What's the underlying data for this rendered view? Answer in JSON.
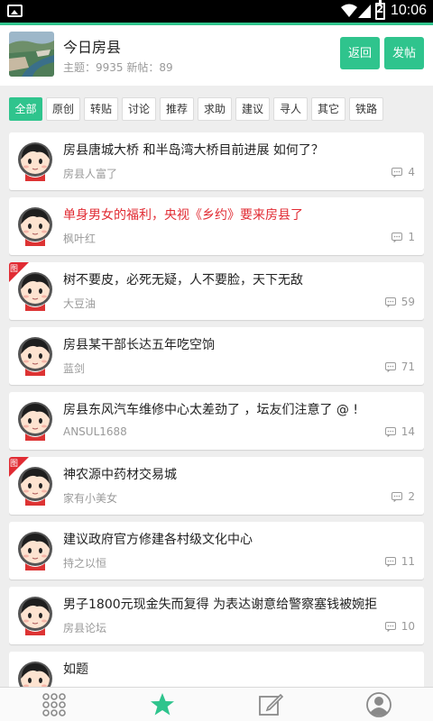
{
  "status_bar": {
    "time": "10:06",
    "battery_label": "2"
  },
  "header": {
    "title": "今日房县",
    "stats": "主题：9935 新帖：89",
    "back_label": "返回",
    "post_label": "发帖"
  },
  "tabs": [
    {
      "label": "全部",
      "active": true
    },
    {
      "label": "原创"
    },
    {
      "label": "转贴"
    },
    {
      "label": "讨论"
    },
    {
      "label": "推荐"
    },
    {
      "label": "求助"
    },
    {
      "label": "建议"
    },
    {
      "label": "寻人"
    },
    {
      "label": "其它"
    },
    {
      "label": "铁路"
    }
  ],
  "posts": [
    {
      "title": "房县唐城大桥 和半岛湾大桥目前进展 如何了？",
      "author": "房县人富了",
      "replies": "4"
    },
    {
      "title": "单身男女的福利，央视《乡约》要来房县了",
      "author": "枫叶红",
      "replies": "1",
      "highlight": true
    },
    {
      "title": "树不要皮，必死无疑，人不要脸，天下无敌",
      "author": "大豆油",
      "replies": "59",
      "has_image": true,
      "badge": "图"
    },
    {
      "title": "房县某干部长达五年吃空饷",
      "author": "蓝剑",
      "replies": "71"
    },
    {
      "title": "房县东风汽车维修中心太差劲了 ，坛友们注意了 @ !",
      "author": "ANSUL1688",
      "replies": "14"
    },
    {
      "title": "神农源中药材交易城",
      "author": "家有小美女",
      "replies": "2",
      "has_image": true,
      "badge": "图"
    },
    {
      "title": "建议政府官方修建各村级文化中心",
      "author": "持之以恒",
      "replies": "11"
    },
    {
      "title": "男子1800元现金失而复得 为表达谢意给警察塞钱被婉拒",
      "author": "房县论坛",
      "replies": "10"
    },
    {
      "title": "如题",
      "author": "",
      "replies": ""
    }
  ],
  "bottom_nav": [
    {
      "icon": "grid-icon"
    },
    {
      "icon": "star-icon",
      "active": true
    },
    {
      "icon": "compose-icon"
    },
    {
      "icon": "profile-icon"
    }
  ],
  "colors": {
    "accent": "#2fc48d",
    "highlight": "#e12b33",
    "badge": "#e12b33"
  }
}
